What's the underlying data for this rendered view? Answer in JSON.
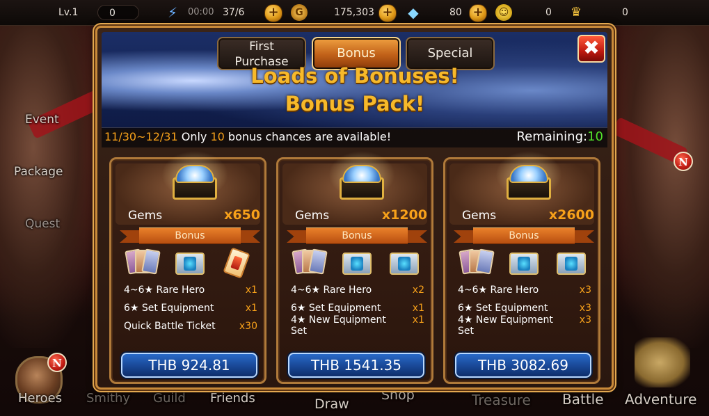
{
  "top_bar": {
    "level_label": "Lv.1",
    "name_value": "0",
    "stamina_timer": "00:00",
    "stamina_count": "37/6",
    "gold": "175,303",
    "gems": "80",
    "friendship": "0",
    "honor": "0"
  },
  "left_menu": {
    "event_label": "Event",
    "package_label": "Package",
    "quest_label": "Quest"
  },
  "dialog": {
    "tabs": [
      {
        "label_line1": "First",
        "label_line2": "Purchase"
      },
      {
        "label_line1": "Bonus",
        "label_line2": ""
      },
      {
        "label_line1": "Special",
        "label_line2": ""
      }
    ],
    "active_tab": "Bonus",
    "close_label": "✖",
    "headline_line1": "Loads of Bonuses!",
    "headline_line2": "Bonus Pack!",
    "info_dates": "11/30~12/31",
    "info_only": "Only",
    "info_chances": "10",
    "info_rest": "bonus chances are available!",
    "remaining_label": "Remaining:",
    "remaining_value": "10"
  },
  "packs": [
    {
      "gem_label": "Gems",
      "gem_count": "x650",
      "bonus_label": "Bonus",
      "rewards": [
        {
          "name": "4~6★ Rare Hero",
          "qty": "x1"
        },
        {
          "name": "6★ Set Equipment",
          "qty": "x1"
        },
        {
          "name": "Quick Battle Ticket",
          "qty": "x30"
        }
      ],
      "price": "THB 924.81"
    },
    {
      "gem_label": "Gems",
      "gem_count": "x1200",
      "bonus_label": "Bonus",
      "rewards": [
        {
          "name": "4~6★ Rare Hero",
          "qty": "x2"
        },
        {
          "name": "6★ Set Equipment",
          "qty": "x1"
        },
        {
          "name": "4★ New Equipment Set",
          "qty": "x1"
        }
      ],
      "price": "THB 1541.35"
    },
    {
      "gem_label": "Gems",
      "gem_count": "x2600",
      "bonus_label": "Bonus",
      "rewards": [
        {
          "name": "4~6★ Rare Hero",
          "qty": "x3"
        },
        {
          "name": "6★ Set Equipment",
          "qty": "x3"
        },
        {
          "name": "4★ New Equipment Set",
          "qty": "x3"
        }
      ],
      "price": "THB 3082.69"
    }
  ],
  "bottom_nav": {
    "heroes": "Heroes",
    "smithy": "Smithy",
    "guild": "Guild",
    "friends": "Friends",
    "draw": "Draw",
    "shop": "Shop",
    "treasure": "Treasure",
    "battle": "Battle",
    "adventure": "Adventure"
  },
  "badge_letter": "N",
  "colors": {
    "accent_orange": "#f7a11a",
    "remaining_green": "#52e02a",
    "headline_gold": "#f7b92a",
    "price_blue": "#1a4a9a"
  }
}
